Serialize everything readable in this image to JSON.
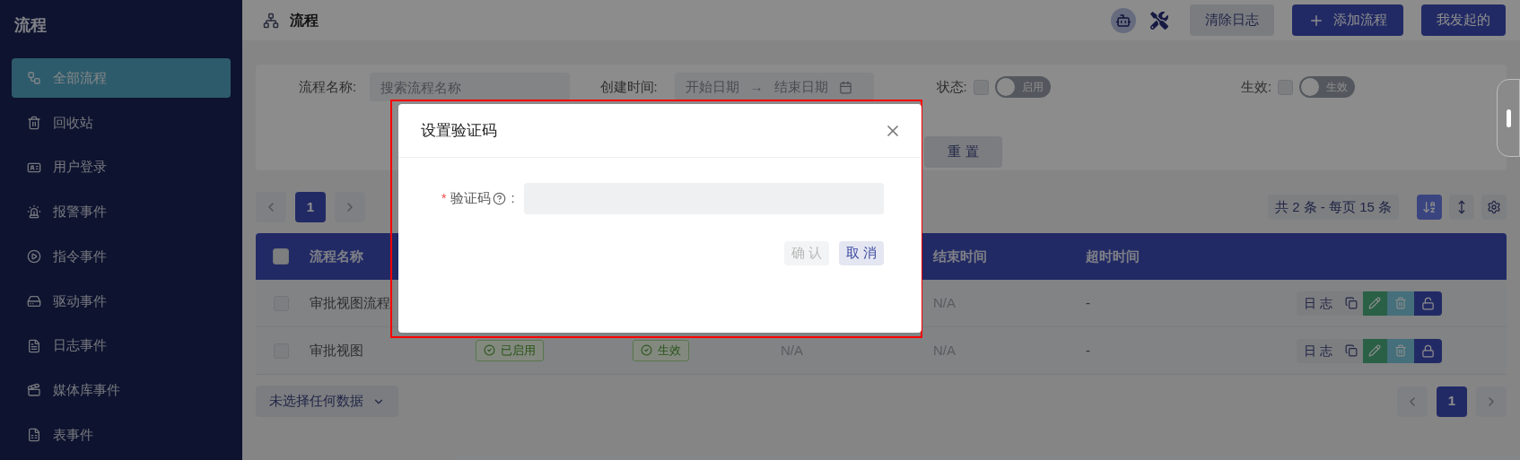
{
  "sidebar": {
    "title": "流程",
    "items": [
      {
        "label": "全部流程",
        "selected": true
      },
      {
        "label": "回收站",
        "selected": false
      },
      {
        "label": "用户登录",
        "selected": false
      },
      {
        "label": "报警事件",
        "selected": false
      },
      {
        "label": "指令事件",
        "selected": false
      },
      {
        "label": "驱动事件",
        "selected": false
      },
      {
        "label": "日志事件",
        "selected": false
      },
      {
        "label": "媒体库事件",
        "selected": false
      },
      {
        "label": "表事件",
        "selected": false
      }
    ]
  },
  "header": {
    "title": "流程",
    "buttons": [
      {
        "label": "清除日志",
        "kind": "secondary"
      },
      {
        "label": "添加流程",
        "kind": "add"
      },
      {
        "label": "我发起的",
        "kind": "primary"
      }
    ]
  },
  "filters": {
    "name": {
      "label": "流程名称:",
      "placeholder": "搜索流程名称"
    },
    "created": {
      "label": "创建时间:",
      "start_placeholder": "开始日期",
      "arrow": "→",
      "end_placeholder": "结束日期"
    },
    "status": {
      "label": "状态:",
      "checked": false,
      "toggle_label": "启用",
      "on": false
    },
    "effective": {
      "label": "生效:",
      "checked": false,
      "toggle_label": "生效",
      "on": false
    },
    "reset_button": "重 置"
  },
  "top_pager": {
    "pages": [
      {
        "label": "1",
        "selected": true
      }
    ]
  },
  "summary": "共 2 条 - 每页 15 条",
  "view_tools": [
    {
      "selected": true
    },
    {
      "selected": false
    },
    {
      "selected": false
    }
  ],
  "table": {
    "header_checked": false,
    "columns": [
      "流程名称",
      "结束时间",
      "超时时间"
    ],
    "rows": [
      {
        "checked": false,
        "name": "审批视图流程",
        "end_time": "N/A",
        "timeout": "-",
        "log_button": "日 志",
        "locked": false
      },
      {
        "checked": false,
        "name": "审批视图",
        "status": "已启用",
        "effective": "生效",
        "start_time": "N/A",
        "end_time": "N/A",
        "timeout": "-",
        "log_button": "日 志",
        "locked": true
      }
    ]
  },
  "selection_button": "未选择任何数据",
  "bottom_pager": {
    "pages": [
      {
        "label": "1",
        "selected": true
      }
    ]
  },
  "dialog": {
    "highlighted": true,
    "title": "设置验证码",
    "field": {
      "required_mark": "*",
      "label": "验证码",
      "colon": ":"
    },
    "buttons": [
      {
        "label": "确 认",
        "disabled": true
      },
      {
        "label": "取 消",
        "disabled": false
      }
    ]
  }
}
